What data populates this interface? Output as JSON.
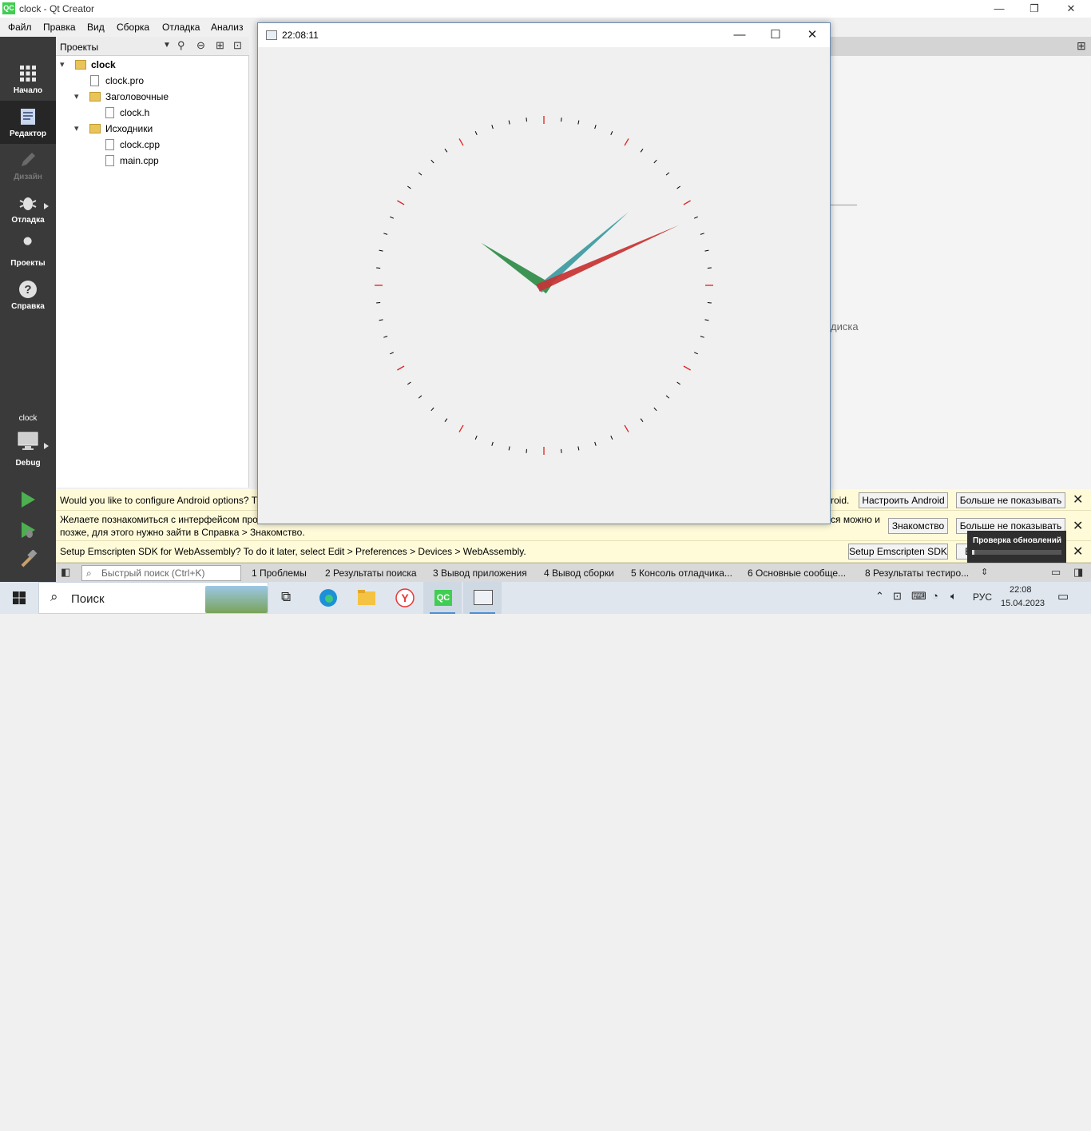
{
  "window": {
    "title": "clock - Qt Creator",
    "app_icon_text": "QC",
    "minimize": "—",
    "maximize": "❐",
    "close": "✕"
  },
  "menu": [
    "Файл",
    "Правка",
    "Вид",
    "Сборка",
    "Отладка",
    "Анализ"
  ],
  "modes": [
    {
      "label": "Начало",
      "icon": "grid-icon"
    },
    {
      "label": "Редактор",
      "icon": "editor-icon",
      "active": true
    },
    {
      "label": "Дизайн",
      "icon": "pen-icon",
      "disabled": true
    },
    {
      "label": "Отладка",
      "icon": "bug-icon"
    },
    {
      "label": "Проекты",
      "icon": "wrench-icon"
    },
    {
      "label": "Справка",
      "icon": "help-icon"
    }
  ],
  "target": {
    "project": "clock",
    "config": "Debug"
  },
  "projects_panel": {
    "title": "Проекты",
    "tree": {
      "root": "clock",
      "pro": "clock.pro",
      "headers": "Заголовочные",
      "header_file": "clock.h",
      "sources": "Исходники",
      "source1": "clock.cpp",
      "source2": "main.cpp"
    }
  },
  "clock_window": {
    "title": "22:08:11",
    "minimize": "—",
    "maximize": "☐",
    "close": "✕",
    "time": {
      "hours": 22,
      "minutes": 8,
      "seconds": 11
    }
  },
  "behind_text": "диска",
  "infobars": [
    {
      "text": "Would you like to configure Android options? T",
      "text_tail": "roid.",
      "btn1": "Настроить Android",
      "btn2": "Больше не показывать"
    },
    {
      "line1": "Желаете познакомиться с интерфейсом про",
      "line1_tail": "ся можно и",
      "line2": "позже, для этого нужно зайти в Справка > Знакомство.",
      "btn1": "Знакомство",
      "btn2": "Больше не показывать"
    },
    {
      "text": "Setup Emscripten SDK for WebAssembly? To do it later, select Edit > Preferences > Devices > WebAssembly.",
      "btn1": "Setup Emscripten SDK",
      "btn2": "Б"
    }
  ],
  "update_popup": {
    "text": "Проверка обновлений"
  },
  "output": {
    "locator_placeholder": "Быстрый поиск (Ctrl+K)",
    "tabs": [
      "1  Проблемы",
      "2  Результаты поиска",
      "3  Вывод приложения",
      "4  Вывод сборки",
      "5  Консоль отладчика...",
      "6  Основные сообще...",
      "8  Результаты тестиро..."
    ]
  },
  "taskbar": {
    "search": "Поиск",
    "lang": "РУС",
    "time": "22:08",
    "date": "15.04.2023"
  },
  "colors": {
    "hour_hand": "#2e8b45",
    "minute_hand": "#3c9aa0",
    "second_hand": "#c83232",
    "hour_tick": "#e02020",
    "minute_tick": "#000000"
  }
}
